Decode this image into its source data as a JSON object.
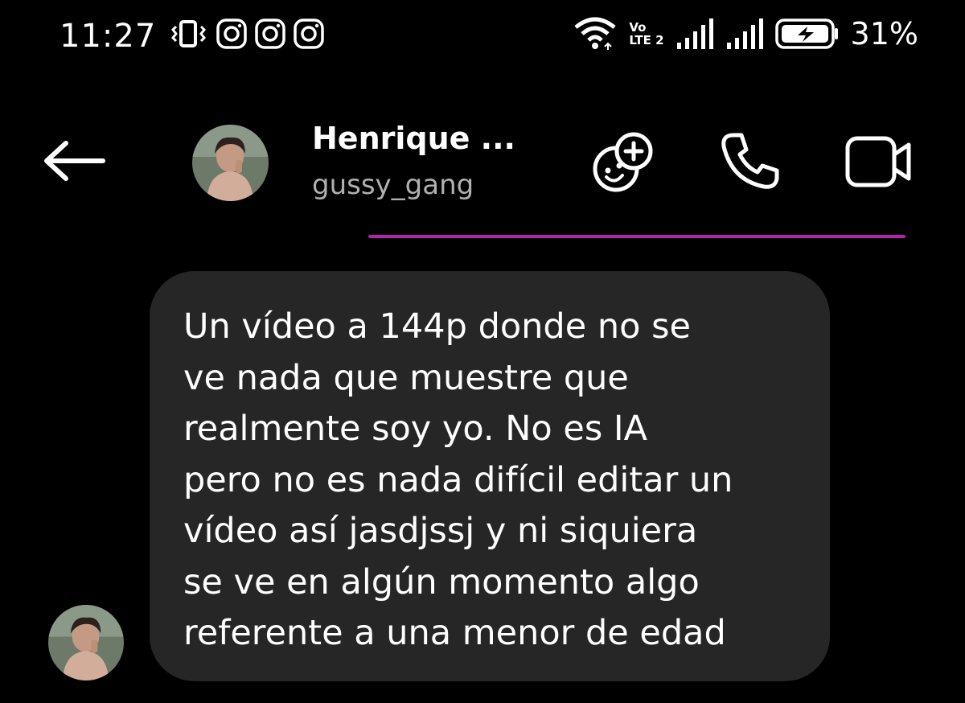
{
  "status_bar": {
    "time": "11:27",
    "volte_top": "Vo",
    "volte_bottom": "LTE 2",
    "battery_percent": "31%",
    "left_icons": [
      "vibrate-icon",
      "instagram-icon",
      "instagram-icon",
      "instagram-icon"
    ],
    "right_icons": [
      "wifi-icon",
      "volte-icon",
      "signal-icon",
      "signal-icon",
      "battery-charging-icon"
    ]
  },
  "header": {
    "name": "Henrique ...",
    "username": "gussy_gang",
    "actions": [
      "effects-icon",
      "voice-call-icon",
      "video-call-icon"
    ],
    "accent_color": "#b61fb0"
  },
  "messages": [
    {
      "from": "other",
      "text": "Un vídeo a 144p donde no se\nve nada que muestre que\nrealmente soy yo. No es IA\npero no es nada difícil editar un\nvídeo así jasdjssj y ni siquiera\nse ve en algún momento algo\nreferente a una menor de edad"
    }
  ]
}
